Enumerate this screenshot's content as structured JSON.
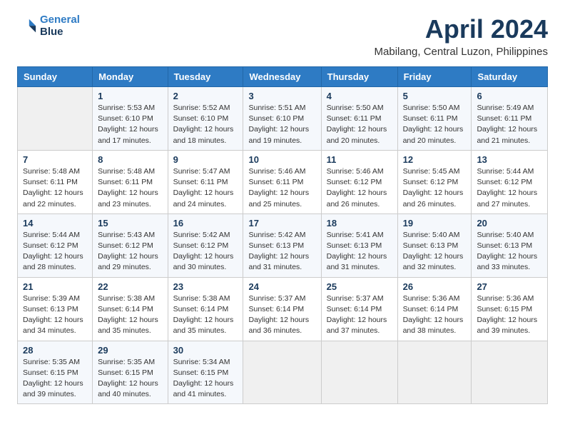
{
  "logo": {
    "line1": "General",
    "line2": "Blue"
  },
  "title": "April 2024",
  "subtitle": "Mabilang, Central Luzon, Philippines",
  "header": {
    "days": [
      "Sunday",
      "Monday",
      "Tuesday",
      "Wednesday",
      "Thursday",
      "Friday",
      "Saturday"
    ]
  },
  "weeks": [
    [
      {
        "day": "",
        "info": ""
      },
      {
        "day": "1",
        "info": "Sunrise: 5:53 AM\nSunset: 6:10 PM\nDaylight: 12 hours\nand 17 minutes."
      },
      {
        "day": "2",
        "info": "Sunrise: 5:52 AM\nSunset: 6:10 PM\nDaylight: 12 hours\nand 18 minutes."
      },
      {
        "day": "3",
        "info": "Sunrise: 5:51 AM\nSunset: 6:10 PM\nDaylight: 12 hours\nand 19 minutes."
      },
      {
        "day": "4",
        "info": "Sunrise: 5:50 AM\nSunset: 6:11 PM\nDaylight: 12 hours\nand 20 minutes."
      },
      {
        "day": "5",
        "info": "Sunrise: 5:50 AM\nSunset: 6:11 PM\nDaylight: 12 hours\nand 20 minutes."
      },
      {
        "day": "6",
        "info": "Sunrise: 5:49 AM\nSunset: 6:11 PM\nDaylight: 12 hours\nand 21 minutes."
      }
    ],
    [
      {
        "day": "7",
        "info": "Sunrise: 5:48 AM\nSunset: 6:11 PM\nDaylight: 12 hours\nand 22 minutes."
      },
      {
        "day": "8",
        "info": "Sunrise: 5:48 AM\nSunset: 6:11 PM\nDaylight: 12 hours\nand 23 minutes."
      },
      {
        "day": "9",
        "info": "Sunrise: 5:47 AM\nSunset: 6:11 PM\nDaylight: 12 hours\nand 24 minutes."
      },
      {
        "day": "10",
        "info": "Sunrise: 5:46 AM\nSunset: 6:11 PM\nDaylight: 12 hours\nand 25 minutes."
      },
      {
        "day": "11",
        "info": "Sunrise: 5:46 AM\nSunset: 6:12 PM\nDaylight: 12 hours\nand 26 minutes."
      },
      {
        "day": "12",
        "info": "Sunrise: 5:45 AM\nSunset: 6:12 PM\nDaylight: 12 hours\nand 26 minutes."
      },
      {
        "day": "13",
        "info": "Sunrise: 5:44 AM\nSunset: 6:12 PM\nDaylight: 12 hours\nand 27 minutes."
      }
    ],
    [
      {
        "day": "14",
        "info": "Sunrise: 5:44 AM\nSunset: 6:12 PM\nDaylight: 12 hours\nand 28 minutes."
      },
      {
        "day": "15",
        "info": "Sunrise: 5:43 AM\nSunset: 6:12 PM\nDaylight: 12 hours\nand 29 minutes."
      },
      {
        "day": "16",
        "info": "Sunrise: 5:42 AM\nSunset: 6:12 PM\nDaylight: 12 hours\nand 30 minutes."
      },
      {
        "day": "17",
        "info": "Sunrise: 5:42 AM\nSunset: 6:13 PM\nDaylight: 12 hours\nand 31 minutes."
      },
      {
        "day": "18",
        "info": "Sunrise: 5:41 AM\nSunset: 6:13 PM\nDaylight: 12 hours\nand 31 minutes."
      },
      {
        "day": "19",
        "info": "Sunrise: 5:40 AM\nSunset: 6:13 PM\nDaylight: 12 hours\nand 32 minutes."
      },
      {
        "day": "20",
        "info": "Sunrise: 5:40 AM\nSunset: 6:13 PM\nDaylight: 12 hours\nand 33 minutes."
      }
    ],
    [
      {
        "day": "21",
        "info": "Sunrise: 5:39 AM\nSunset: 6:13 PM\nDaylight: 12 hours\nand 34 minutes."
      },
      {
        "day": "22",
        "info": "Sunrise: 5:38 AM\nSunset: 6:14 PM\nDaylight: 12 hours\nand 35 minutes."
      },
      {
        "day": "23",
        "info": "Sunrise: 5:38 AM\nSunset: 6:14 PM\nDaylight: 12 hours\nand 35 minutes."
      },
      {
        "day": "24",
        "info": "Sunrise: 5:37 AM\nSunset: 6:14 PM\nDaylight: 12 hours\nand 36 minutes."
      },
      {
        "day": "25",
        "info": "Sunrise: 5:37 AM\nSunset: 6:14 PM\nDaylight: 12 hours\nand 37 minutes."
      },
      {
        "day": "26",
        "info": "Sunrise: 5:36 AM\nSunset: 6:14 PM\nDaylight: 12 hours\nand 38 minutes."
      },
      {
        "day": "27",
        "info": "Sunrise: 5:36 AM\nSunset: 6:15 PM\nDaylight: 12 hours\nand 39 minutes."
      }
    ],
    [
      {
        "day": "28",
        "info": "Sunrise: 5:35 AM\nSunset: 6:15 PM\nDaylight: 12 hours\nand 39 minutes."
      },
      {
        "day": "29",
        "info": "Sunrise: 5:35 AM\nSunset: 6:15 PM\nDaylight: 12 hours\nand 40 minutes."
      },
      {
        "day": "30",
        "info": "Sunrise: 5:34 AM\nSunset: 6:15 PM\nDaylight: 12 hours\nand 41 minutes."
      },
      {
        "day": "",
        "info": ""
      },
      {
        "day": "",
        "info": ""
      },
      {
        "day": "",
        "info": ""
      },
      {
        "day": "",
        "info": ""
      }
    ]
  ]
}
